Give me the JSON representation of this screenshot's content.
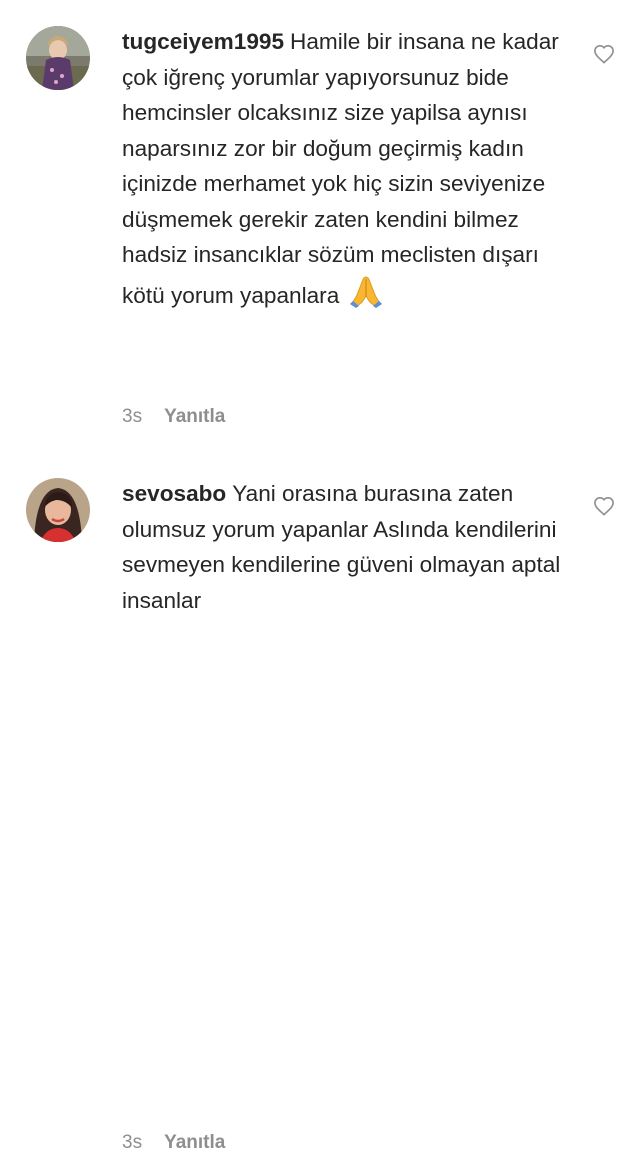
{
  "comments": [
    {
      "username": "tugceiyem1995",
      "text": "Hamile bir insana ne kadar çok iğrenç yorumlar yapıyorsunuz bide hemcinsler olcaksınız size yapilsa aynısı naparsınız zor bir doğum geçirmiş kadın içinizde merhamet yok hiç sizin seviyenize düşmemek gerekir zaten kendini bilmez hadsiz insancıklar sözüm meclisten dışarı kötü yorum yapanlara",
      "emoji": "folded-hands-emoji",
      "time": "3s",
      "reply_label": "Yanıtla",
      "like_icon": "heart-outline-icon"
    },
    {
      "username": "sevosabo",
      "text": "Yani orasına burasına zaten olumsuz yorum yapanlar Aslında kendilerini sevmeyen kendilerine güveni olmayan aptal insanlar",
      "time": "3s",
      "reply_label": "Yanıtla",
      "like_icon": "heart-outline-icon"
    }
  ],
  "colors": {
    "text": "#262626",
    "meta": "#8e8e8e"
  }
}
